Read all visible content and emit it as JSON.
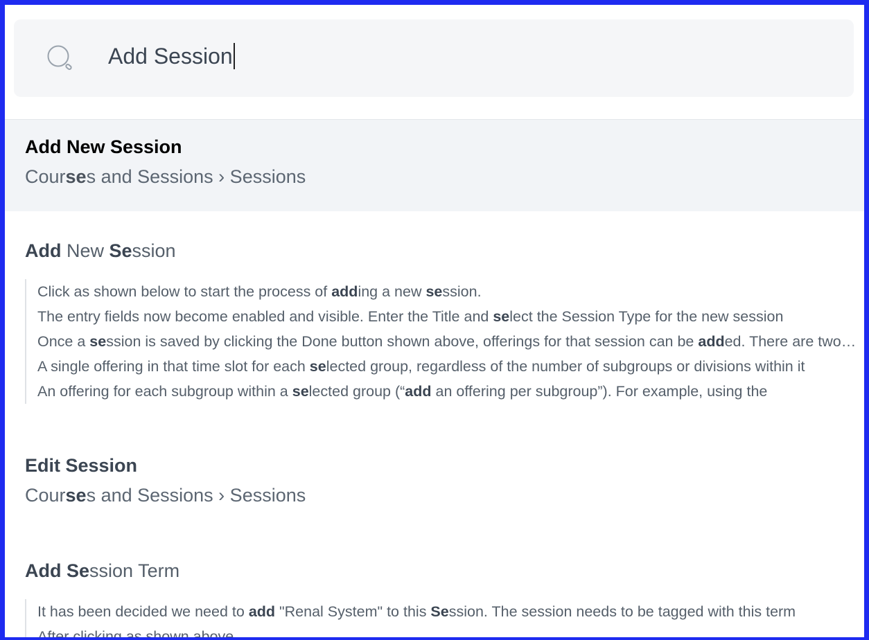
{
  "search": {
    "value": "Add Session"
  },
  "results": [
    {
      "title": "Add New Session",
      "path_parts": [
        "Cour",
        "se",
        "s and Sessions › Sessions"
      ]
    },
    {
      "title_parts": [
        "Add",
        " New ",
        "Se",
        "ssion"
      ],
      "snippets": [
        [
          "Click as shown below to start the process of ",
          "add",
          "ing a new ",
          "se",
          "ssion.",
          "",
          ""
        ],
        [
          "The entry fields now become enabled and visible. Enter the Title and ",
          "se",
          "lect the Session Type for the new session",
          "",
          "",
          "",
          ""
        ],
        [
          "Once a ",
          "se",
          "ssion is saved by clicking the Done button shown above, offerings for that session can be ",
          "add",
          "ed. There are two ways to add offerings",
          "",
          ""
        ],
        [
          "A single offering in that time slot for each ",
          "se",
          "lected group, regardless of the number of subgroups or divisions within it",
          "",
          "",
          "",
          ""
        ],
        [
          "An offering for each subgroup within a ",
          "se",
          "lected group (“",
          "add",
          " an offering per subgroup”). For example, using the",
          "",
          ""
        ]
      ]
    },
    {
      "title": "Edit Session",
      "path_parts": [
        "Cour",
        "se",
        "s and Sessions › Sessions"
      ]
    },
    {
      "title_parts": [
        "Add",
        " ",
        "Se",
        "ssion Term"
      ],
      "snippets": [
        [
          "It has been decided we need to ",
          "add",
          " \"Renal System\" to this ",
          "Se",
          "ssion. The session needs to be tagged with this term",
          "",
          ""
        ],
        [
          "After clicking as shown above",
          "",
          "",
          "",
          "",
          "",
          ""
        ]
      ]
    }
  ]
}
